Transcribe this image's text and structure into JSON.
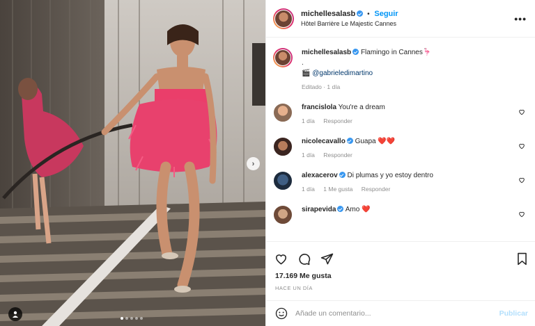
{
  "post": {
    "username": "michellesalasb",
    "follow_label": "Seguir",
    "location": "Hôtel Barrière Le Majestic Cannes",
    "more_label": "•••"
  },
  "caption": {
    "username": "michellesalasb",
    "text": "Flamingo in Cannes",
    "emoji": "🦩",
    "dot_line": ".",
    "camera_emoji": "🎬",
    "mention": "@gabrieledimartino",
    "meta": "Editado · 1 día"
  },
  "comments": [
    {
      "username": "francislola",
      "verified": false,
      "text": "You're a dream",
      "time": "1 día",
      "likes": "",
      "reply": "Responder"
    },
    {
      "username": "nicolecavallo",
      "verified": true,
      "text": "Guapa",
      "emoji": "❤️❤️",
      "time": "1 día",
      "likes": "",
      "reply": "Responder"
    },
    {
      "username": "alexacerov",
      "verified": true,
      "text": "Di plumas y yo estoy dentro",
      "time": "1 día",
      "likes": "1 Me gusta",
      "reply": "Responder"
    },
    {
      "username": "sirapevida",
      "verified": true,
      "text": "Amo",
      "emoji": "❤️",
      "time": "",
      "likes": "",
      "reply": ""
    }
  ],
  "actions": {
    "likes_count": "17.169 Me gusta",
    "time_ago": "HACE UN DÍA"
  },
  "composer": {
    "placeholder": "Añade un comentario...",
    "publish_label": "Publicar"
  },
  "carousel": {
    "total_slides": 5,
    "active_slide": 1,
    "next_icon": "chevron-right-icon"
  },
  "colors": {
    "link_blue": "#0095f6",
    "verified_blue": "#3897f0",
    "publish_disabled": "#b2dffc",
    "muted": "#8e8e8e",
    "dress_pink": "#e8416d"
  }
}
